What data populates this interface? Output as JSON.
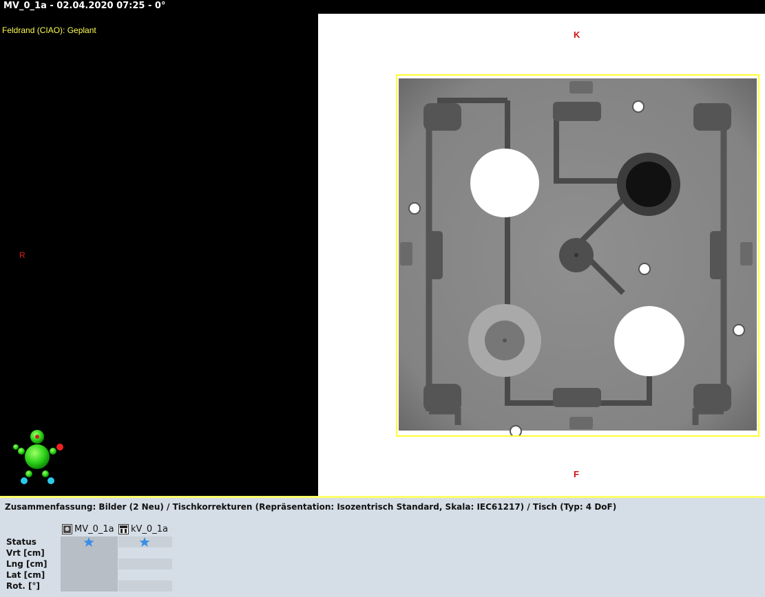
{
  "window": {
    "title": "MV_0_1a - 02.04.2020 07:25 - 0°"
  },
  "left_view": {
    "field_label": "Feldrand (CIAO): Geplant",
    "orientation_right": "R"
  },
  "right_view": {
    "orientation_top": "K",
    "orientation_bottom": "F"
  },
  "summary": {
    "text": "Zusammenfassung: Bilder (2 Neu) / Tischkorrekturen (Repräsentation: Isozentrisch Standard, Skala: IEC61217) / Tisch (Typ: 4 DoF)",
    "columns": [
      {
        "label": "MV_0_1a",
        "icon": "mv-image-icon"
      },
      {
        "label": "kV_0_1a",
        "icon": "kv-image-icon"
      }
    ],
    "rows": [
      {
        "label": "Status",
        "values": [
          "",
          ""
        ],
        "icon": "star-icon"
      },
      {
        "label": "Vrt [cm]",
        "values": [
          "",
          ""
        ]
      },
      {
        "label": "Lng [cm]",
        "values": [
          "",
          ""
        ]
      },
      {
        "label": "Lat [cm]",
        "values": [
          "",
          ""
        ]
      },
      {
        "label": "Rot. [°]",
        "values": [
          "",
          ""
        ]
      }
    ]
  },
  "colors": {
    "field_outline": "#ffff33",
    "accent_star": "#3a8ee6",
    "orientation": "#cc1111"
  }
}
